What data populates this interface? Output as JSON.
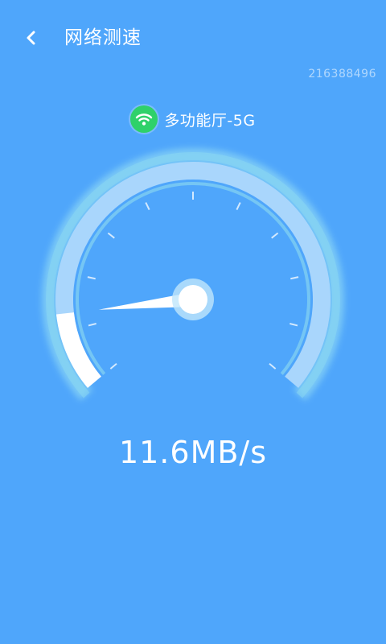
{
  "header": {
    "back_icon": "chevron-left-icon",
    "title": "网络测速"
  },
  "device_id": "216388496",
  "network": {
    "icon": "wifi-icon",
    "badge_color": "#2fd16a",
    "name": "多功能厅-5G"
  },
  "gauge": {
    "progress_fraction": 0.13,
    "needle_fraction": 0.13,
    "colors": {
      "background": "#4fa6fb",
      "track": "#a9d6fc",
      "fill": "#ffffff",
      "glow": "#9fe6f2"
    }
  },
  "speed": {
    "value": "11.6MB/s"
  }
}
